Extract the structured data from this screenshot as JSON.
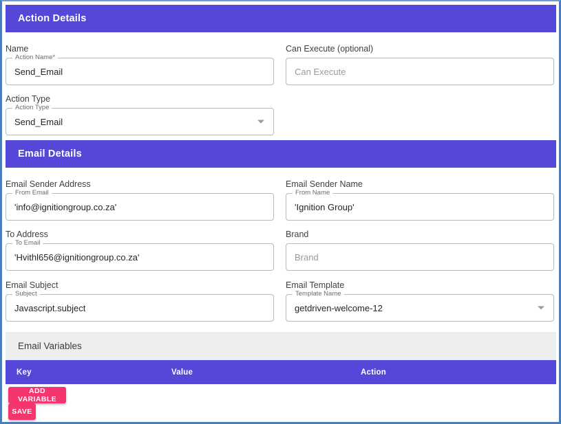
{
  "sections": {
    "action_details": {
      "title": "Action Details"
    },
    "email_details": {
      "title": "Email Details"
    },
    "email_variables": {
      "title": "Email Variables"
    }
  },
  "action_details_form": {
    "name": {
      "label": "Name",
      "legend": "Action Name*",
      "value": "Send_Email"
    },
    "can_execute": {
      "label": "Can Execute (optional)",
      "placeholder": "Can Execute",
      "value": ""
    },
    "action_type": {
      "label": "Action Type",
      "legend": "Action Type",
      "value": "Send_Email",
      "options": [
        "Send_Email"
      ]
    }
  },
  "email_details_form": {
    "sender_address": {
      "label": "Email Sender Address",
      "legend": "From Email",
      "value": "'info@ignitiongroup.co.za'"
    },
    "sender_name": {
      "label": "Email Sender Name",
      "legend": "From Name",
      "value": "'Ignition Group'"
    },
    "to_address": {
      "label": "To Address",
      "legend": "To Email",
      "value": "'Hvithl656@ignitiongroup.co.za'"
    },
    "brand": {
      "label": "Brand",
      "placeholder": "Brand",
      "value": ""
    },
    "subject": {
      "label": "Email Subject",
      "legend": "Subject",
      "value": "Javascript.subject"
    },
    "template": {
      "label": "Email Template",
      "legend": "Template Name",
      "value": "getdriven-welcome-12",
      "options": [
        "getdriven-welcome-12"
      ]
    }
  },
  "variables_table": {
    "columns": [
      "Key",
      "Value",
      "Action"
    ],
    "rows": []
  },
  "buttons": {
    "add_variable": "ADD VARIABLE",
    "save": "SAVE"
  },
  "colors": {
    "header_purple": "#5548d9",
    "button_pink": "#f5356e",
    "panel_gray": "#eeeeee",
    "frame_blue": "#4a7ebb"
  }
}
